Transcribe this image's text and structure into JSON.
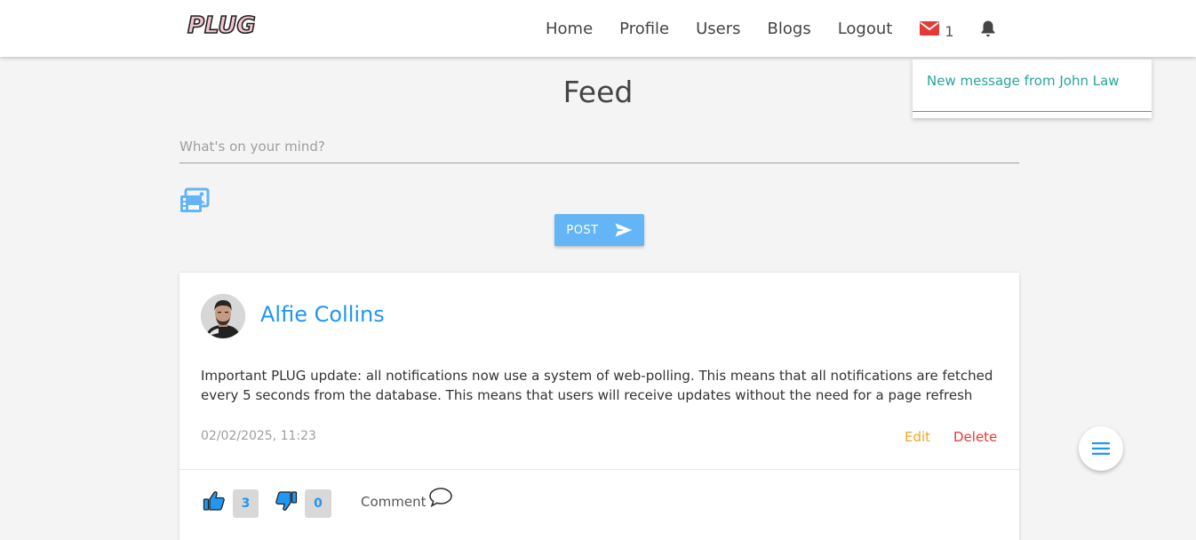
{
  "brand": {
    "logo_text": "PLUG"
  },
  "nav": {
    "links": [
      "Home",
      "Profile",
      "Users",
      "Blogs",
      "Logout"
    ],
    "mail_icon": "mail-icon",
    "mail_count": "1",
    "bell_icon": "bell-icon"
  },
  "notifications": {
    "items": [
      "New message from John Law"
    ]
  },
  "feed": {
    "title": "Feed",
    "input_placeholder": "What's on your mind?",
    "input_value": "",
    "image_icon": "image-upload-icon",
    "post_button_label": "POST",
    "post_button_icon": "send-icon"
  },
  "post": {
    "author": "Alfie Collins",
    "body": "Important PLUG update: all notifications now use a system of web-polling. This means that all notifications are fetched every 5 seconds from the database. This means that users will receive updates without the need for a page refresh",
    "date": "02/02/2025, 11:23",
    "edit_label": "Edit",
    "delete_label": "Delete",
    "likes": "3",
    "dislikes": "0",
    "comment_label": "Comment"
  },
  "fab": {
    "icon": "menu-icon"
  },
  "colors": {
    "accent_blue": "#2196f3",
    "button_blue": "#64b5f6",
    "notification_teal": "#26a69a",
    "edit_orange": "#f5a623",
    "delete_red": "#e53935",
    "mail_red": "#e53935"
  }
}
